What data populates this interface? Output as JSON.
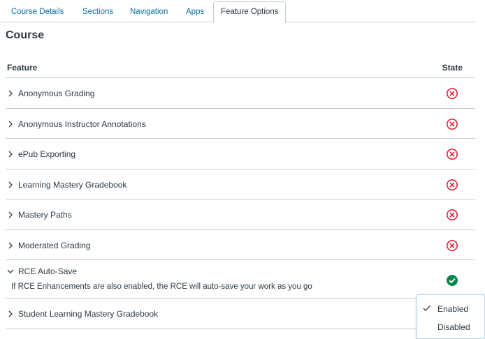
{
  "tabs": [
    {
      "label": "Course Details"
    },
    {
      "label": "Sections"
    },
    {
      "label": "Navigation"
    },
    {
      "label": "Apps"
    },
    {
      "label": "Feature Options",
      "active": true
    }
  ],
  "page_title": "Course",
  "table": {
    "header_feature": "Feature",
    "header_state": "State",
    "rows": [
      {
        "label": "Anonymous Grading",
        "state": "off"
      },
      {
        "label": "Anonymous Instructor Annotations",
        "state": "off"
      },
      {
        "label": "ePub Exporting",
        "state": "off"
      },
      {
        "label": "Learning Mastery Gradebook",
        "state": "off"
      },
      {
        "label": "Mastery Paths",
        "state": "off"
      },
      {
        "label": "Moderated Grading",
        "state": "off"
      },
      {
        "label": "RCE Auto-Save",
        "state": "on",
        "expanded": true,
        "description": "If RCE Enhancements are also enabled, the RCE will auto-save your work as you go"
      },
      {
        "label": "Student Learning Mastery Gradebook",
        "state": "none"
      }
    ]
  },
  "menu": {
    "enabled_label": "Enabled",
    "disabled_label": "Disabled",
    "selected": "Enabled"
  },
  "colors": {
    "link": "#0770a3",
    "off": "#e0061f",
    "on": "#0b874b",
    "border": "#c7cdd1"
  },
  "icons": {
    "collapsed": "chevron-right-icon",
    "expanded": "chevron-down-icon",
    "off": "x-circle-icon",
    "on": "check-circle-icon",
    "menu_check": "checkmark-icon"
  }
}
